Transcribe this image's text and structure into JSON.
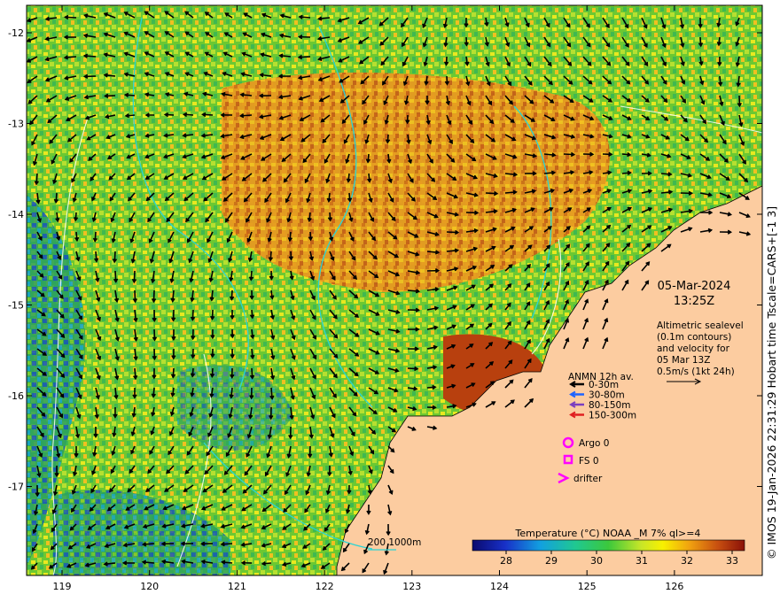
{
  "map": {
    "lat_ticks": [
      "-12",
      "-13",
      "-14",
      "-15",
      "-16",
      "-17"
    ],
    "lon_ticks": [
      "119",
      "120",
      "121",
      "122",
      "123",
      "124",
      "125",
      "126"
    ],
    "date": "05-Mar-2024",
    "time": "13:25Z",
    "altimetry_note": [
      "Altimetric sealevel",
      "(0.1m contours)",
      "and velocity for",
      "05 Mar 13Z",
      "0.5m/s (1kt 24h)"
    ],
    "anmn_title": "ANMN 12h av.",
    "anmn_legend": [
      {
        "label": "0-30m",
        "color": "#000000"
      },
      {
        "label": "30-80m",
        "color": "#1e64ff"
      },
      {
        "label": "80-150m",
        "color": "#7b3fbf"
      },
      {
        "label": "150-300m",
        "color": "#e02020"
      }
    ],
    "argo_label": "Argo 0",
    "fs_label": "FS 0",
    "drifter_label": "drifter",
    "marker_color": "#ff00ff",
    "bathy_label": "200 1000m",
    "colorbar_title": "Temperature (°C) NOAA _M 7% ql>=4",
    "colorbar_ticks": [
      "28",
      "29",
      "30",
      "31",
      "32",
      "33"
    ],
    "credit": "© IMOS 19-Jan-2026 22:31:29 Hobart time Tscale=CARS+[-1 3]",
    "land_color": "#fccca0",
    "contour_color": "#2ad4d4"
  }
}
